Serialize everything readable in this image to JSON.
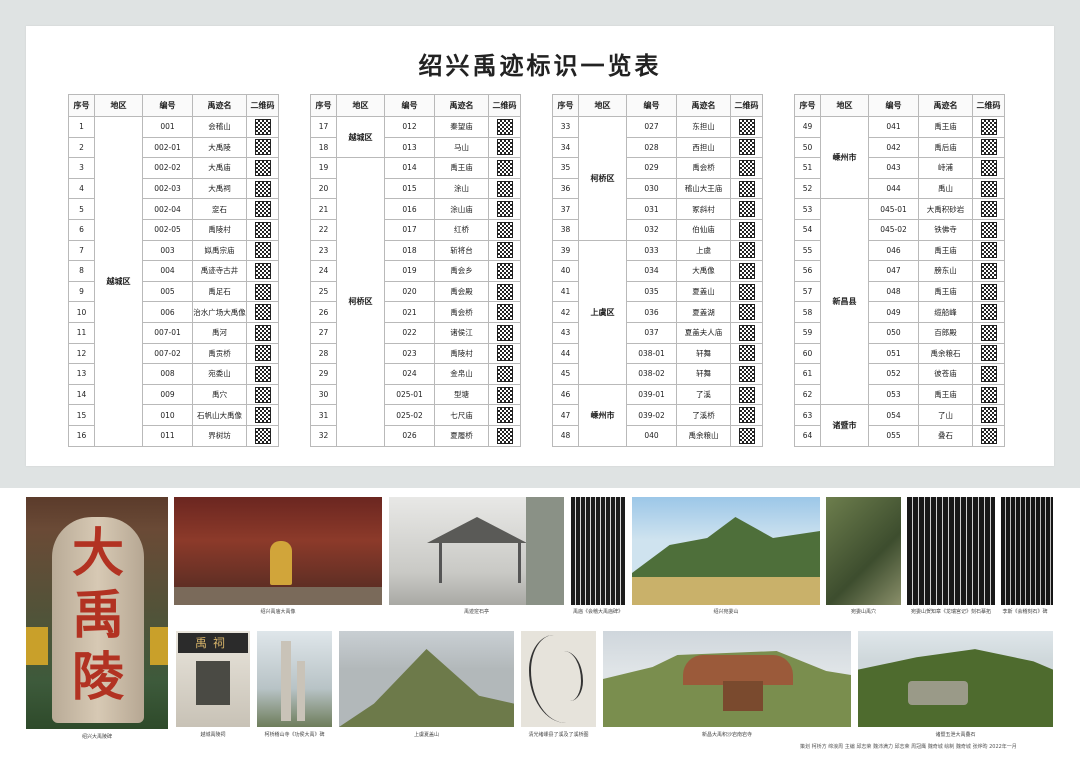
{
  "title": "绍兴禹迹标识一览表",
  "headers": [
    "序号",
    "地区",
    "编号",
    "禹迹名",
    "二维码"
  ],
  "tables": [
    {
      "regions": [
        {
          "name": "越城区",
          "span": 16
        }
      ],
      "rows": [
        {
          "no": "1",
          "code": "001",
          "name": "会稽山"
        },
        {
          "no": "2",
          "code": "002-01",
          "name": "大禹陵"
        },
        {
          "no": "3",
          "code": "002-02",
          "name": "大禹庙"
        },
        {
          "no": "4",
          "code": "002-03",
          "name": "大禹祠"
        },
        {
          "no": "5",
          "code": "002-04",
          "name": "窆石"
        },
        {
          "no": "6",
          "code": "002-05",
          "name": "禹陵村"
        },
        {
          "no": "7",
          "code": "003",
          "name": "姒禹宗庙"
        },
        {
          "no": "8",
          "code": "004",
          "name": "禹迹寺古井"
        },
        {
          "no": "9",
          "code": "005",
          "name": "禹足石"
        },
        {
          "no": "10",
          "code": "006",
          "name": "治水广场大禹像"
        },
        {
          "no": "11",
          "code": "007-01",
          "name": "禹河"
        },
        {
          "no": "12",
          "code": "007-02",
          "name": "禹贡桥"
        },
        {
          "no": "13",
          "code": "008",
          "name": "宛委山"
        },
        {
          "no": "14",
          "code": "009",
          "name": "禹穴"
        },
        {
          "no": "15",
          "code": "010",
          "name": "石帆山大禹像"
        },
        {
          "no": "16",
          "code": "011",
          "name": "界树坊"
        }
      ]
    },
    {
      "regions": [
        {
          "name": "越城区",
          "span": 2
        },
        {
          "name": "柯桥区",
          "span": 14
        }
      ],
      "rows": [
        {
          "no": "17",
          "code": "012",
          "name": "秦望庙"
        },
        {
          "no": "18",
          "code": "013",
          "name": "马山"
        },
        {
          "no": "19",
          "code": "014",
          "name": "禹王庙"
        },
        {
          "no": "20",
          "code": "015",
          "name": "涂山"
        },
        {
          "no": "21",
          "code": "016",
          "name": "涂山庙"
        },
        {
          "no": "22",
          "code": "017",
          "name": "红桥"
        },
        {
          "no": "23",
          "code": "018",
          "name": "斩将台"
        },
        {
          "no": "24",
          "code": "019",
          "name": "禹会乡"
        },
        {
          "no": "25",
          "code": "020",
          "name": "禹会殿"
        },
        {
          "no": "26",
          "code": "021",
          "name": "禹会桥"
        },
        {
          "no": "27",
          "code": "022",
          "name": "诸侯江"
        },
        {
          "no": "28",
          "code": "023",
          "name": "禹陵村"
        },
        {
          "no": "29",
          "code": "024",
          "name": "金帛山"
        },
        {
          "no": "30",
          "code": "025-01",
          "name": "型塘"
        },
        {
          "no": "31",
          "code": "025-02",
          "name": "七尺庙"
        },
        {
          "no": "32",
          "code": "026",
          "name": "夏履桥"
        }
      ]
    },
    {
      "regions": [
        {
          "name": "柯桥区",
          "span": 6
        },
        {
          "name": "上虞区",
          "span": 7
        },
        {
          "name": "嵊州市",
          "span": 3
        }
      ],
      "rows": [
        {
          "no": "33",
          "code": "027",
          "name": "东担山"
        },
        {
          "no": "34",
          "code": "028",
          "name": "西担山"
        },
        {
          "no": "35",
          "code": "029",
          "name": "禹会桥"
        },
        {
          "no": "36",
          "code": "030",
          "name": "稽山大王庙"
        },
        {
          "no": "37",
          "code": "031",
          "name": "冢斜村"
        },
        {
          "no": "38",
          "code": "032",
          "name": "伯仙庙"
        },
        {
          "no": "39",
          "code": "033",
          "name": "上虞"
        },
        {
          "no": "40",
          "code": "034",
          "name": "大禹像"
        },
        {
          "no": "41",
          "code": "035",
          "name": "夏盖山"
        },
        {
          "no": "42",
          "code": "036",
          "name": "夏盖湖"
        },
        {
          "no": "43",
          "code": "037",
          "name": "夏盖夫人庙"
        },
        {
          "no": "44",
          "code": "038-01",
          "name": "轩舞"
        },
        {
          "no": "45",
          "code": "038-02",
          "name": "轩舞"
        },
        {
          "no": "46",
          "code": "039-01",
          "name": "了溪"
        },
        {
          "no": "47",
          "code": "039-02",
          "name": "了溪桥"
        },
        {
          "no": "48",
          "code": "040",
          "name": "禹余粮山"
        }
      ]
    },
    {
      "regions": [
        {
          "name": "嵊州市",
          "span": 4
        },
        {
          "name": "新昌县",
          "span": 10
        },
        {
          "name": "诸暨市",
          "span": 2
        }
      ],
      "rows": [
        {
          "no": "49",
          "code": "041",
          "name": "禹王庙"
        },
        {
          "no": "50",
          "code": "042",
          "name": "禹后庙"
        },
        {
          "no": "51",
          "code": "043",
          "name": "峙浦"
        },
        {
          "no": "52",
          "code": "044",
          "name": "禹山"
        },
        {
          "no": "53",
          "code": "045-01",
          "name": "大禹积砂岩"
        },
        {
          "no": "54",
          "code": "045-02",
          "name": "铁佛寺"
        },
        {
          "no": "55",
          "code": "046",
          "name": "禹王庙"
        },
        {
          "no": "56",
          "code": "047",
          "name": "膀东山"
        },
        {
          "no": "57",
          "code": "048",
          "name": "禹王庙"
        },
        {
          "no": "58",
          "code": "049",
          "name": "缆船峰"
        },
        {
          "no": "59",
          "code": "050",
          "name": "百郎殿"
        },
        {
          "no": "60",
          "code": "051",
          "name": "禹余粮石"
        },
        {
          "no": "61",
          "code": "052",
          "name": "彼苍庙"
        },
        {
          "no": "62",
          "code": "053",
          "name": "禹王庙"
        },
        {
          "no": "63",
          "code": "054",
          "name": "了山"
        },
        {
          "no": "64",
          "code": "055",
          "name": "叠石"
        }
      ]
    }
  ],
  "gallery": {
    "stele_chars": [
      "大",
      "禹",
      "陵"
    ],
    "plaque_text": "禹祠",
    "captions": [
      "绍兴大禹陵碑",
      "绍兴禹庙大禹像",
      "禹迹窆石亭",
      "禹庙《会稽大禹庙碑》",
      "绍兴宛委山",
      "宛委山禹穴",
      "宛委山贺知章《龙瑞宫记》刻石摹拓",
      "李斯《会稽刻石》碑",
      "越城禹陵祠",
      "柯桥稽山寺《功侯大禹》碑",
      "上虞夏盖山",
      "清光绪嵊县了溪及了溪桥图",
      "新昌大禹积沙岩南岩寺",
      "诸暨五泄大禹叠石"
    ],
    "credits": "策划 柯桥方 绵浪周 主编 邱志荣 魏沛满力 邱志荣 周冠鹰 魏奇城 绘制 魏奇城 张烨昀 2022年一月"
  }
}
